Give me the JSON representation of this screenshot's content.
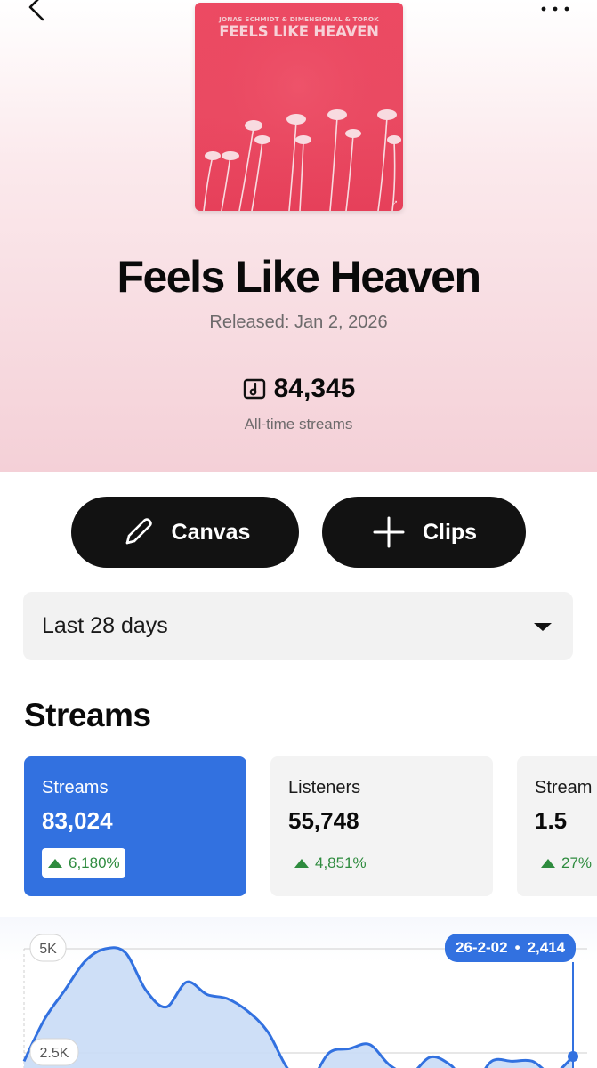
{
  "header": {
    "back_icon": "chevron-left-icon",
    "more_icon": "more-horizontal-icon"
  },
  "cover": {
    "artists": "JONAS SCHMIDT & DIMENSIONAL & TOROK",
    "title": "FEELS LIKE HEAVEN"
  },
  "track": {
    "title": "Feels Like Heaven",
    "released": "Released: Jan 2, 2026",
    "total_streams": "84,345",
    "total_streams_caption": "All-time streams"
  },
  "actions": {
    "canvas_label": "Canvas",
    "clips_label": "Clips"
  },
  "filter": {
    "selected": "Last 28 days"
  },
  "streams_section": {
    "title": "Streams",
    "cards": [
      {
        "label": "Streams",
        "value": "83,024",
        "change": "6,180%",
        "active": true
      },
      {
        "label": "Listeners",
        "value": "55,748",
        "change": "4,851%",
        "active": false
      },
      {
        "label": "Stream",
        "value": "1.5",
        "change": "27%",
        "active": false
      }
    ]
  },
  "chart": {
    "y_ticks": [
      "5K",
      "2.5K"
    ],
    "tooltip_date": "26-2-02",
    "tooltip_sep": "•",
    "tooltip_value": "2,414"
  },
  "colors": {
    "accent_blue": "#3271e0",
    "positive_green": "#2e8b3e",
    "pill_black": "#121212",
    "cover_red": "#ea4a62"
  },
  "chart_data": {
    "type": "area",
    "ylabel": "",
    "ylim": [
      0,
      5000
    ],
    "y_ticks": [
      2500,
      5000
    ],
    "values": [
      2300,
      3300,
      4000,
      4700,
      5000,
      4900,
      4000,
      3600,
      4200,
      3900,
      3800,
      3500,
      3000,
      2100,
      1800,
      2500,
      2600,
      2700,
      2200,
      2000,
      2400,
      2200,
      1700,
      2300,
      2300,
      2300,
      2000,
      2414
    ]
  }
}
